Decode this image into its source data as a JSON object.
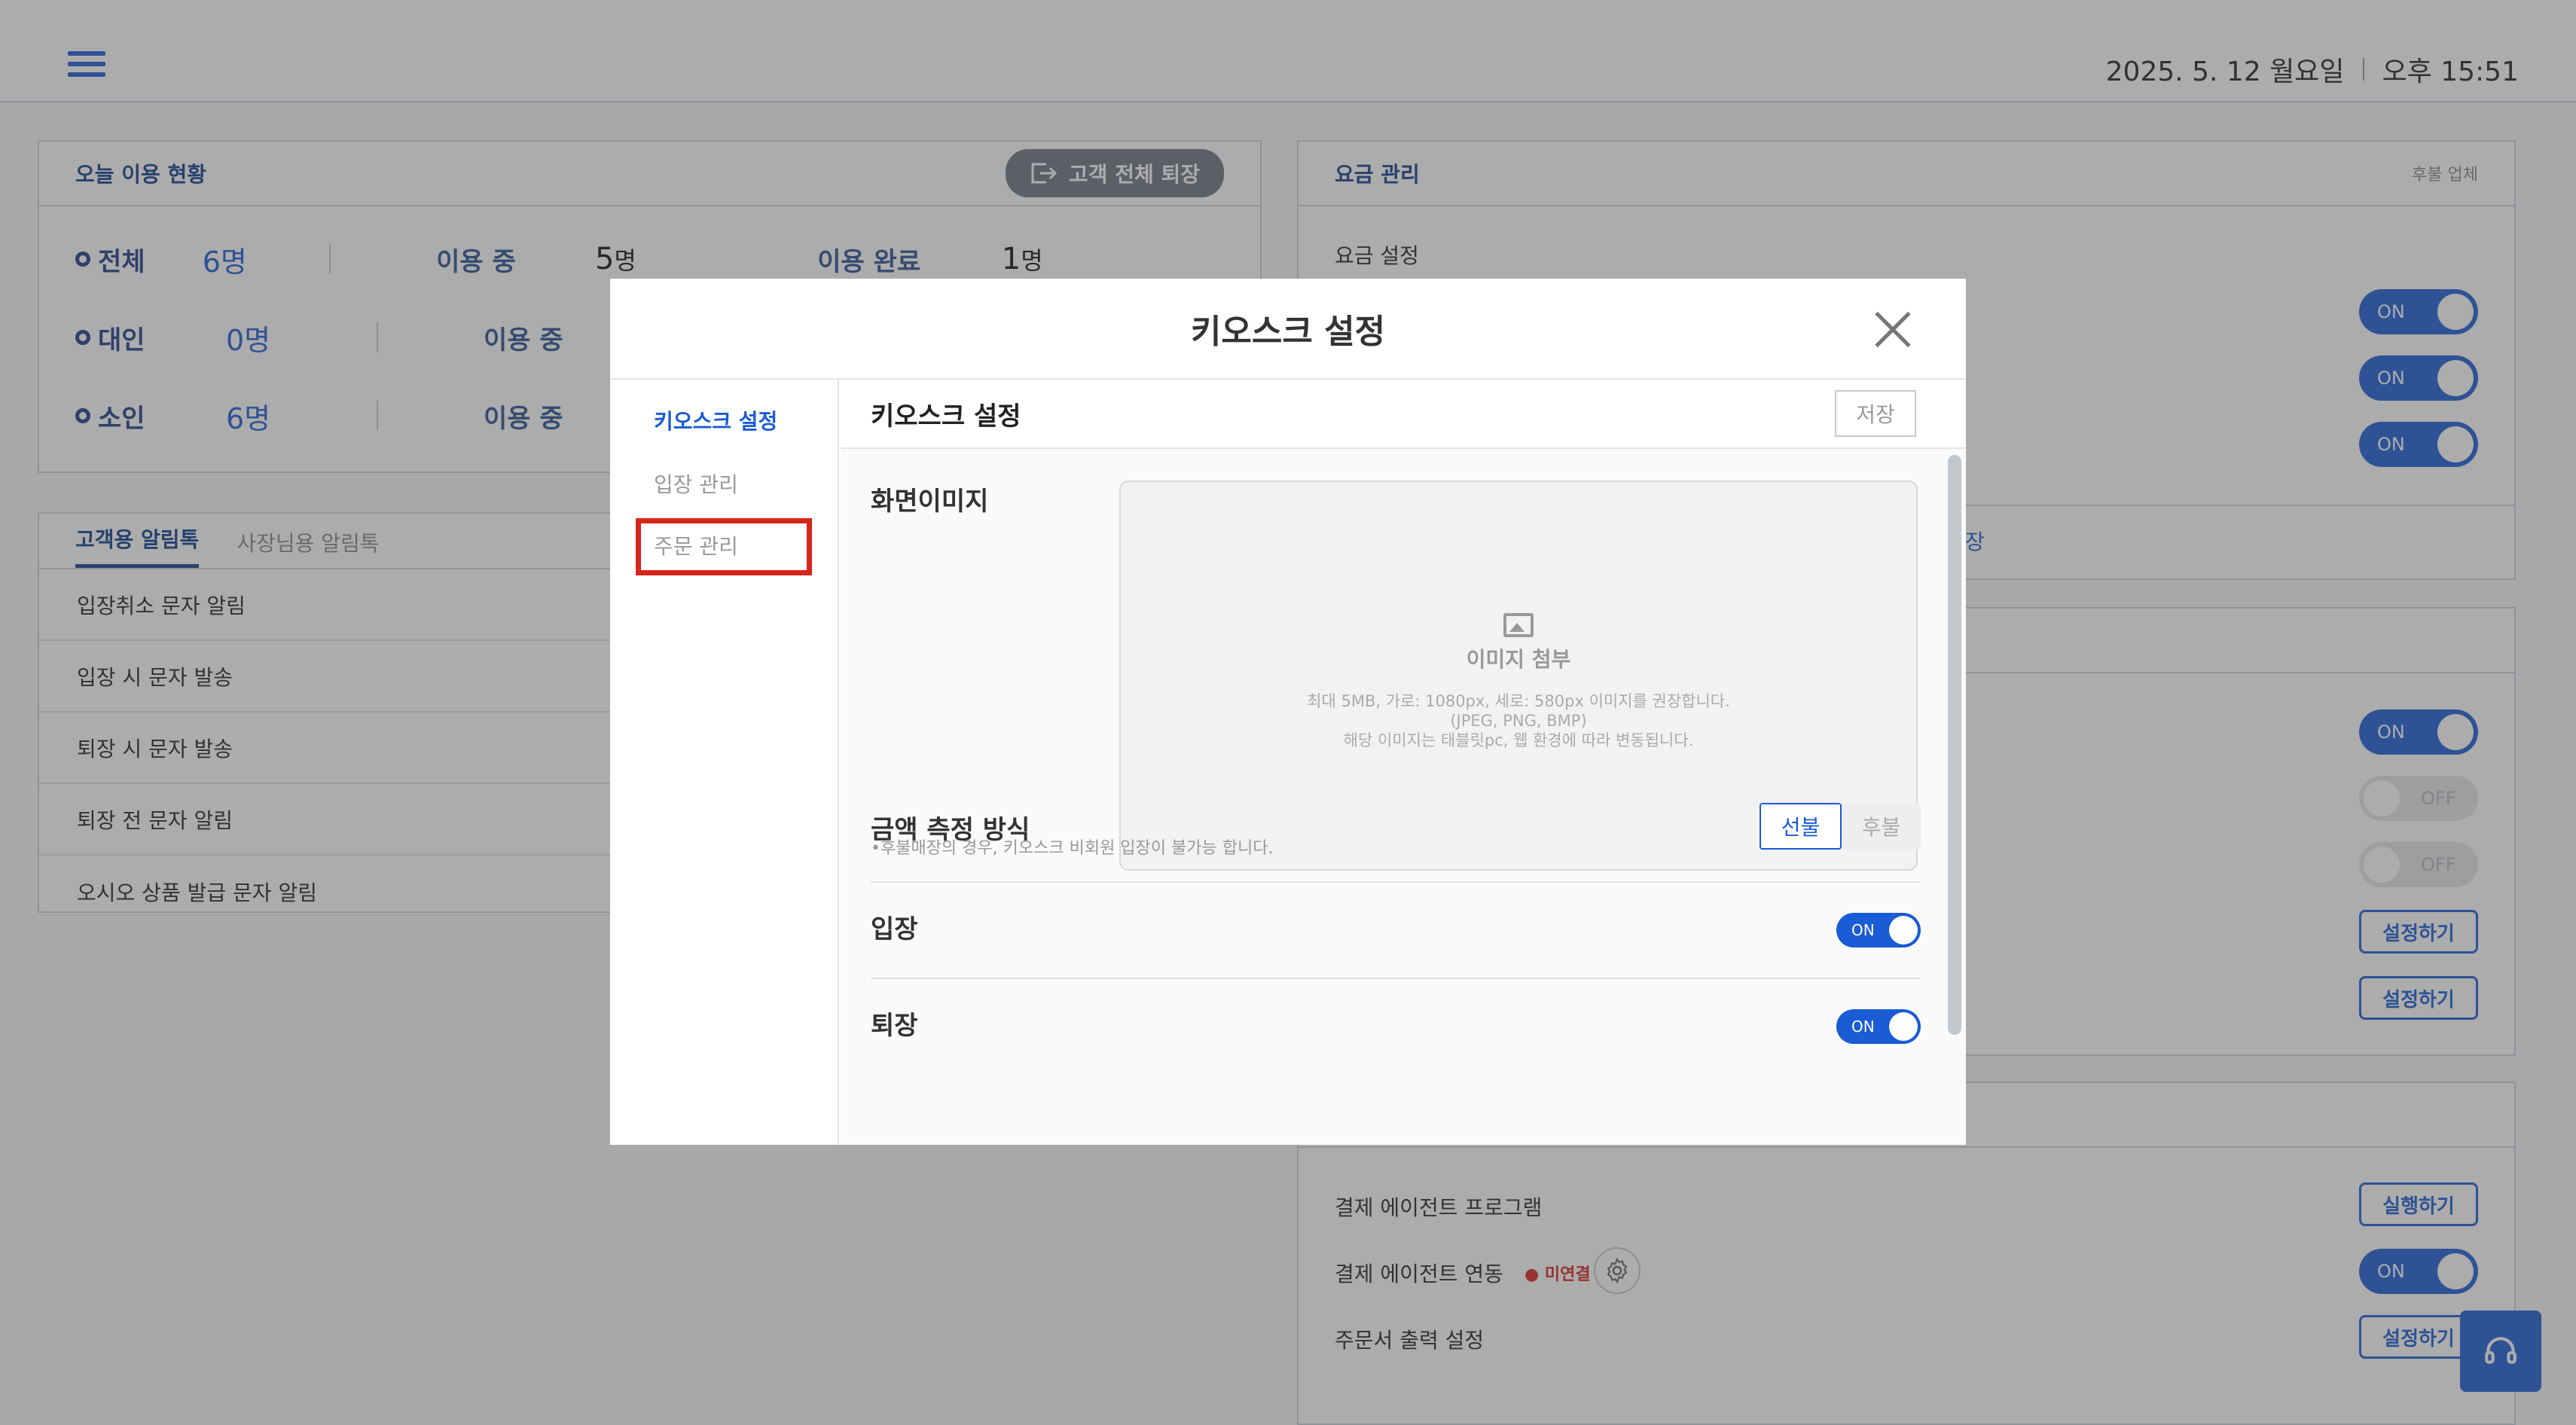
{
  "header": {
    "date": "2025. 5. 12 월요일",
    "time": "오후 15:51"
  },
  "usage": {
    "title": "오늘 이용 현황",
    "checkout_all": "고객 전체 퇴장",
    "rows": [
      {
        "label": "전체",
        "count": "6명",
        "in_use_label": "이용 중",
        "in_use": "5",
        "unit": "명",
        "done_label": "이용 완료",
        "done": "1",
        "done_unit": "명"
      },
      {
        "label": "대인",
        "count": "0명",
        "in_use_label": "이용 중"
      },
      {
        "label": "소인",
        "count": "6명",
        "in_use_label": "이용 중"
      }
    ]
  },
  "alimtalk": {
    "tabs": [
      "고객용 알림톡",
      "사장님용 알림톡"
    ],
    "items": [
      "입장취소 문자 알림",
      "입장 시 문자 발송",
      "퇴장 시 문자 발송",
      "퇴장 전 문자 알림",
      "오시오 상품 발급 문자 알림"
    ]
  },
  "fee": {
    "title": "요금 관리",
    "right_note": "후불 업체",
    "setting_label": "요금 설정",
    "partial_link": "장"
  },
  "toggles": {
    "on": "ON",
    "off": "OFF"
  },
  "buttons": {
    "configure": "설정하기",
    "run": "실행하기"
  },
  "payment": {
    "agent_program": "결제 에이전트 프로그램",
    "agent_link": "결제 에이전트 연동",
    "status": "미연결",
    "print_setting": "주문서 출력 설정"
  },
  "modal": {
    "title": "키오스크 설정",
    "menu": [
      "키오스크 설정",
      "입장 관리",
      "주문 관리"
    ],
    "section_title": "키오스크 설정",
    "save": "저장",
    "screen_image_label": "화면이미지",
    "upload_title": "이미지 첨부",
    "upload_note_1": "최대 5MB, 가로: 1080px, 세로: 580px 이미지를 권장합니다.",
    "upload_note_2": "(JPEG, PNG, BMP)",
    "upload_note_3": "해당 이미지는 태블릿pc, 웹 환경에 따라 변동됩니다.",
    "amount_label": "금액 측정 방식",
    "amount_note": "•후불매장의 경우, 키오스크 비회원 입장이 불가능 합니다.",
    "prepaid": "선불",
    "postpaid": "후불",
    "entry_label": "입장",
    "exit_label": "퇴장",
    "toggle_on": "ON"
  }
}
